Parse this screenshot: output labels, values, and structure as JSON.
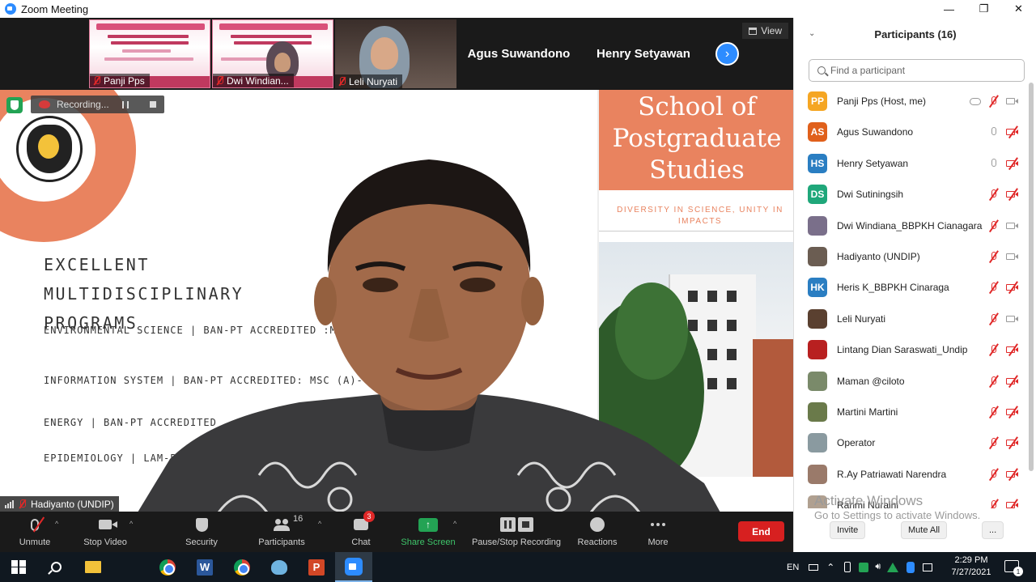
{
  "window": {
    "title": "Zoom Meeting",
    "minimize": "—",
    "restore": "❐",
    "close": "✕"
  },
  "strip": {
    "tiles": [
      {
        "name": "Panji Pps"
      },
      {
        "name": "Dwi Windian..."
      },
      {
        "name": "Leli Nuryati"
      }
    ],
    "name_tiles": [
      "Agus Suwandono",
      "Henry Setyawan"
    ],
    "next_glyph": "›",
    "view_label": "View"
  },
  "recording": {
    "label": "Recording..."
  },
  "slide": {
    "title_line1": "EXCELLENT MULTIDISCIPLINARY",
    "title_line2": "PROGRAMS",
    "programs": [
      "ENVIRONMENTAL SCIENCE  |  BAN-PT ACCREDITED :MSC (A)",
      "INFORMATION SYSTEM |  BAN-PT ACCREDITED: MSC (A)-  PHD (",
      "ENERGY  |  BAN-PT ACCREDITED",
      "EPIDEMIOLOGY  |  LAM-P"
    ],
    "school_line1": "School of",
    "school_line2": "Postgraduate",
    "school_line3": "Studies",
    "tagline": "DIVERSITY IN SCIENCE, UNITY IN IMPACTS",
    "accent_color": "#e9835f"
  },
  "active_speaker": {
    "name": "Hadiyanto (UNDIP)"
  },
  "toolbar": {
    "unmute": "Unmute",
    "stop_video": "Stop Video",
    "security": "Security",
    "participants": "Participants",
    "participants_count": "16",
    "chat": "Chat",
    "chat_badge": "3",
    "share_screen": "Share Screen",
    "pause_stop": "Pause/Stop Recording",
    "reactions": "Reactions",
    "more": "More",
    "end": "End",
    "caret": "^"
  },
  "panel": {
    "title": "Participants (16)",
    "chevron": "⌄",
    "search_placeholder": "Find a participant",
    "participants": [
      {
        "initials": "PP",
        "name": "Panji Pps (Host, me)",
        "color": "#f5a623",
        "mic": "muted",
        "cam": "on"
      },
      {
        "initials": "AS",
        "name": "Agus Suwandono",
        "color": "#e0601b",
        "mic": "on",
        "cam": "off"
      },
      {
        "initials": "HS",
        "name": "Henry Setyawan",
        "color": "#2a7ec2",
        "mic": "on",
        "cam": "off"
      },
      {
        "initials": "DS",
        "name": "Dwi Sutiningsih",
        "color": "#1fa77a",
        "mic": "muted",
        "cam": "off"
      },
      {
        "initials": "",
        "name": "Dwi Windiana_BBPKH Cianagara",
        "color": "#7a6f8a",
        "mic": "muted",
        "cam": "on"
      },
      {
        "initials": "",
        "name": "Hadiyanto (UNDIP)",
        "color": "#6b5d52",
        "mic": "muted",
        "cam": "on"
      },
      {
        "initials": "HK",
        "name": "Heris K_BBPKH Cinaraga",
        "color": "#2a7ec2",
        "mic": "muted",
        "cam": "off"
      },
      {
        "initials": "",
        "name": "Leli Nuryati",
        "color": "#5a4030",
        "mic": "muted",
        "cam": "on"
      },
      {
        "initials": "",
        "name": "Lintang Dian Saraswati_Undip",
        "color": "#b82020",
        "mic": "muted",
        "cam": "off"
      },
      {
        "initials": "",
        "name": "Maman @ciloto",
        "color": "#7a8a6a",
        "mic": "muted",
        "cam": "off"
      },
      {
        "initials": "",
        "name": "Martini Martini",
        "color": "#6a7a4a",
        "mic": "muted",
        "cam": "off"
      },
      {
        "initials": "",
        "name": "Operator",
        "color": "#8a9aa0",
        "mic": "muted",
        "cam": "off"
      },
      {
        "initials": "",
        "name": "R.Ay Patriawati Narendra",
        "color": "#9a7a6a",
        "mic": "muted",
        "cam": "off"
      },
      {
        "initials": "",
        "name": "Rahmi Nuraini",
        "color": "#b0a090",
        "mic": "muted",
        "cam": "off"
      }
    ],
    "watermark_line1": "Activate Windows",
    "watermark_line2": "Go to Settings to activate Windows.",
    "invite": "Invite",
    "mute_all": "Mute All",
    "more": "..."
  },
  "taskbar": {
    "lang": "EN",
    "word_letter": "W",
    "ppt_letter": "P",
    "time": "2:29 PM",
    "date": "7/27/2021",
    "notif_count": "1"
  }
}
